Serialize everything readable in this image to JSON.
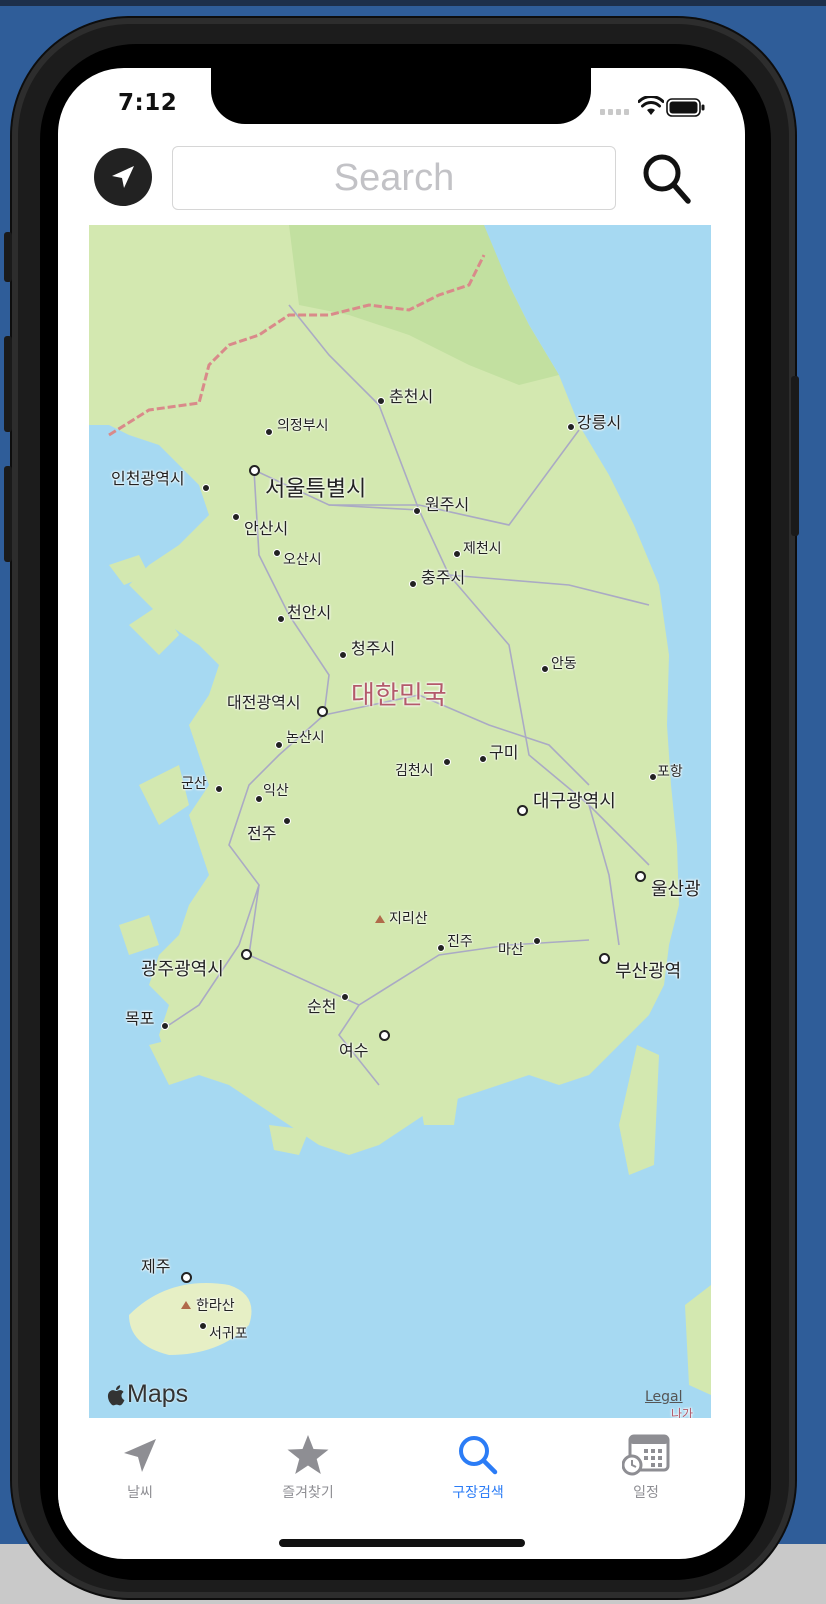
{
  "status_bar": {
    "time": "7:12"
  },
  "search": {
    "placeholder": "Search"
  },
  "map": {
    "attribution": "Maps",
    "legal": "Legal",
    "country_label": "대한민국",
    "cities": {
      "chuncheon": "춘천시",
      "gangneung": "강릉시",
      "uijeongbu": "의정부시",
      "incheon": "인천광역시",
      "seoul": "서울특별시",
      "wonju": "원주시",
      "ansan": "안산시",
      "jecheon": "제천시",
      "osan": "오산시",
      "chungju": "충주시",
      "cheonan": "천안시",
      "cheongju": "청주시",
      "andong": "안동",
      "daejeon": "대전광역시",
      "nonsan": "논산시",
      "gumi": "구미",
      "gimcheon": "김천시",
      "pohang": "포항",
      "gunsan": "군산",
      "iksan": "익산",
      "daegu": "대구광역시",
      "jeonju": "전주",
      "ulsan": "울산광",
      "jirisan": "지리산",
      "jinju": "진주",
      "masan": "마산",
      "gwangju": "광주광역시",
      "busan": "부산광역",
      "suncheon": "순천",
      "mokpo": "목포",
      "yeosu": "여수",
      "jeju": "제주",
      "hallasan": "한라산",
      "seogwipo": "서귀포",
      "naga": "나가"
    }
  },
  "tabs": [
    {
      "label": "날씨",
      "icon": "location-arrow-icon",
      "active": false
    },
    {
      "label": "즐겨찾기",
      "icon": "star-icon",
      "active": false
    },
    {
      "label": "구장검색",
      "icon": "search-icon",
      "active": true
    },
    {
      "label": "일정",
      "icon": "calendar-clock-icon",
      "active": false
    }
  ],
  "colors": {
    "accent": "#2b7cf6",
    "inactive": "#8e8e93",
    "water": "#a6d9f2",
    "land": "#d3e8b0",
    "country_label": "#b35a6a",
    "border_line": "#d98a8a"
  }
}
